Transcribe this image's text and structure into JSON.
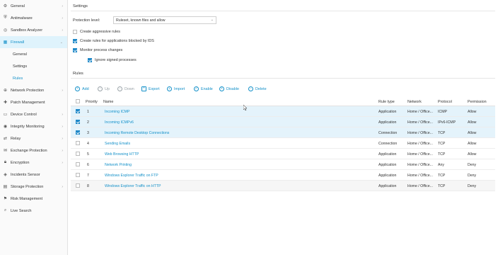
{
  "sidebar": {
    "items": [
      {
        "label": "General",
        "icon": "gear-icon"
      },
      {
        "label": "Antimalware",
        "icon": "shield-icon"
      },
      {
        "label": "Sandbox Analyzer",
        "icon": "sandbox-icon"
      },
      {
        "label": "Firewall",
        "icon": "firewall-icon"
      },
      {
        "label": "Network Protection",
        "icon": "globe-icon"
      },
      {
        "label": "Patch Management",
        "icon": "patch-icon"
      },
      {
        "label": "Device Control",
        "icon": "device-icon"
      },
      {
        "label": "Integrity Monitoring",
        "icon": "monitor-icon"
      },
      {
        "label": "Relay",
        "icon": "relay-icon"
      },
      {
        "label": "Exchange Protection",
        "icon": "exchange-icon"
      },
      {
        "label": "Encryption",
        "icon": "lock-icon"
      },
      {
        "label": "Incidents Sensor",
        "icon": "sensor-icon"
      },
      {
        "label": "Storage Protection",
        "icon": "storage-icon"
      },
      {
        "label": "Risk Management",
        "icon": "risk-icon"
      },
      {
        "label": "Live Search",
        "icon": "search-icon"
      }
    ],
    "firewall_sub": [
      "General",
      "Settings",
      "Rules"
    ]
  },
  "settings": {
    "title": "Settings",
    "protection_label": "Protection level:",
    "protection_value": "Ruleset, known files and allow",
    "options": [
      {
        "label": "Create aggressive rules",
        "checked": false
      },
      {
        "label": "Create rules for applications blocked by IDS",
        "checked": true
      },
      {
        "label": "Monitor process changes",
        "checked": true
      },
      {
        "label": "Ignore signed processes",
        "checked": true
      }
    ]
  },
  "rules": {
    "title": "Rules",
    "toolbar": {
      "add": "Add",
      "up": "Up",
      "down": "Down",
      "export": "Export",
      "import": "Import",
      "enable": "Enable",
      "disable": "Disable",
      "delete": "Delete"
    },
    "columns": {
      "priority": "Priority",
      "name": "Name",
      "rule_type": "Rule type",
      "network": "Network",
      "protocol": "Protocol",
      "permission": "Permission"
    },
    "rows": [
      {
        "checked": true,
        "priority": "1",
        "name": "Incoming ICMP",
        "type": "Application",
        "network": "Home / Office...",
        "protocol": "ICMP",
        "permission": "Allow"
      },
      {
        "checked": true,
        "priority": "2",
        "name": "Incoming ICMPv6",
        "type": "Application",
        "network": "Home / Office...",
        "protocol": "IPv6-ICMP",
        "permission": "Allow"
      },
      {
        "checked": true,
        "priority": "3",
        "name": "Incoming Remote Desktop Connections",
        "type": "Connection",
        "network": "Home / Office...",
        "protocol": "TCP",
        "permission": "Allow"
      },
      {
        "checked": false,
        "priority": "4",
        "name": "Sending Emails",
        "type": "Connection",
        "network": "Home / Office...",
        "protocol": "TCP",
        "permission": "Allow"
      },
      {
        "checked": false,
        "priority": "5",
        "name": "Web Browsing HTTP",
        "type": "Application",
        "network": "Home / Office...",
        "protocol": "TCP",
        "permission": "Allow"
      },
      {
        "checked": false,
        "priority": "6",
        "name": "Network Printing",
        "type": "Application",
        "network": "Home / Office...",
        "protocol": "Any",
        "permission": "Deny"
      },
      {
        "checked": false,
        "priority": "7",
        "name": "Windows Explorer Traffic on FTP",
        "type": "Application",
        "network": "Home / Office...",
        "protocol": "TCP",
        "permission": "Deny"
      },
      {
        "checked": false,
        "priority": "8",
        "name": "Windows Explorer Traffic on HTTP",
        "type": "Application",
        "network": "Home / Office...",
        "protocol": "TCP",
        "permission": "Deny"
      }
    ]
  },
  "colors": {
    "accent": "#1591c9",
    "selected_row": "#e4f3fb"
  }
}
